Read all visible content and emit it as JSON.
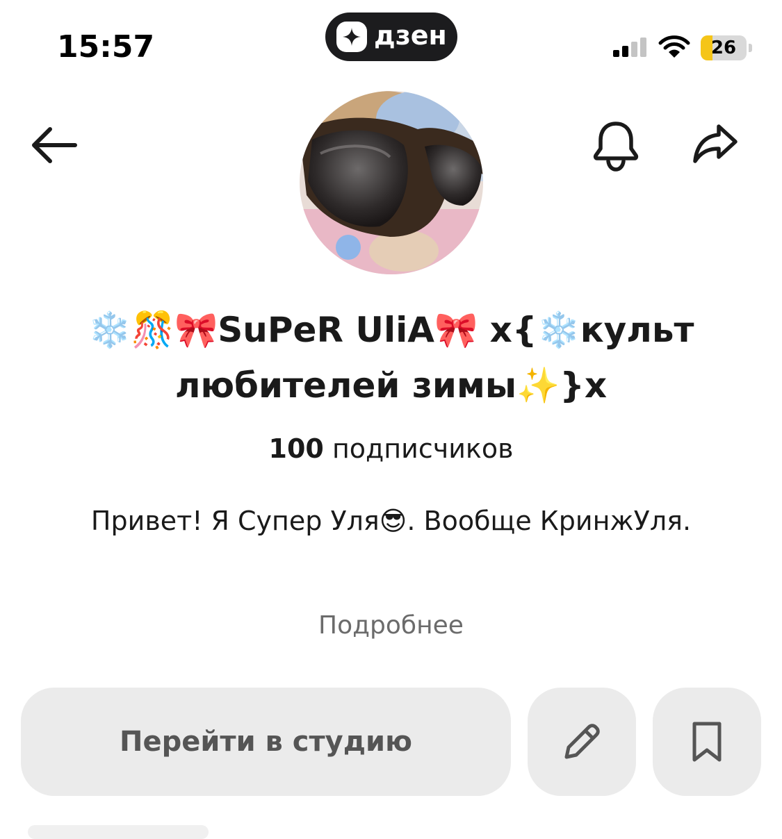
{
  "status_bar": {
    "time": "15:57",
    "app_badge": "дзен",
    "battery_level": "26",
    "battery_fraction": 0.26
  },
  "header": {
    "back_icon": "arrow-left-icon",
    "notifications_icon": "bell-icon",
    "share_icon": "share-arrow-icon"
  },
  "channel": {
    "title": "❄️🎊🎀SuPeR UliA🎀 x{❄️культ любителей зимы✨}x",
    "subscribers_count": "100",
    "subscribers_label": "подписчиков",
    "description": "Привет! Я Супер Уля😎. Вообще КринжУля.",
    "more_label": "Подробнее"
  },
  "actions": {
    "studio_label": "Перейти в студию",
    "edit_icon": "pencil-icon",
    "bookmark_icon": "bookmark-icon"
  },
  "colors": {
    "button_bg": "#ebebeb",
    "muted_text": "#6b6b6b",
    "dzen_pill": "#1c1c1e",
    "battery_fill": "#f5c518"
  }
}
